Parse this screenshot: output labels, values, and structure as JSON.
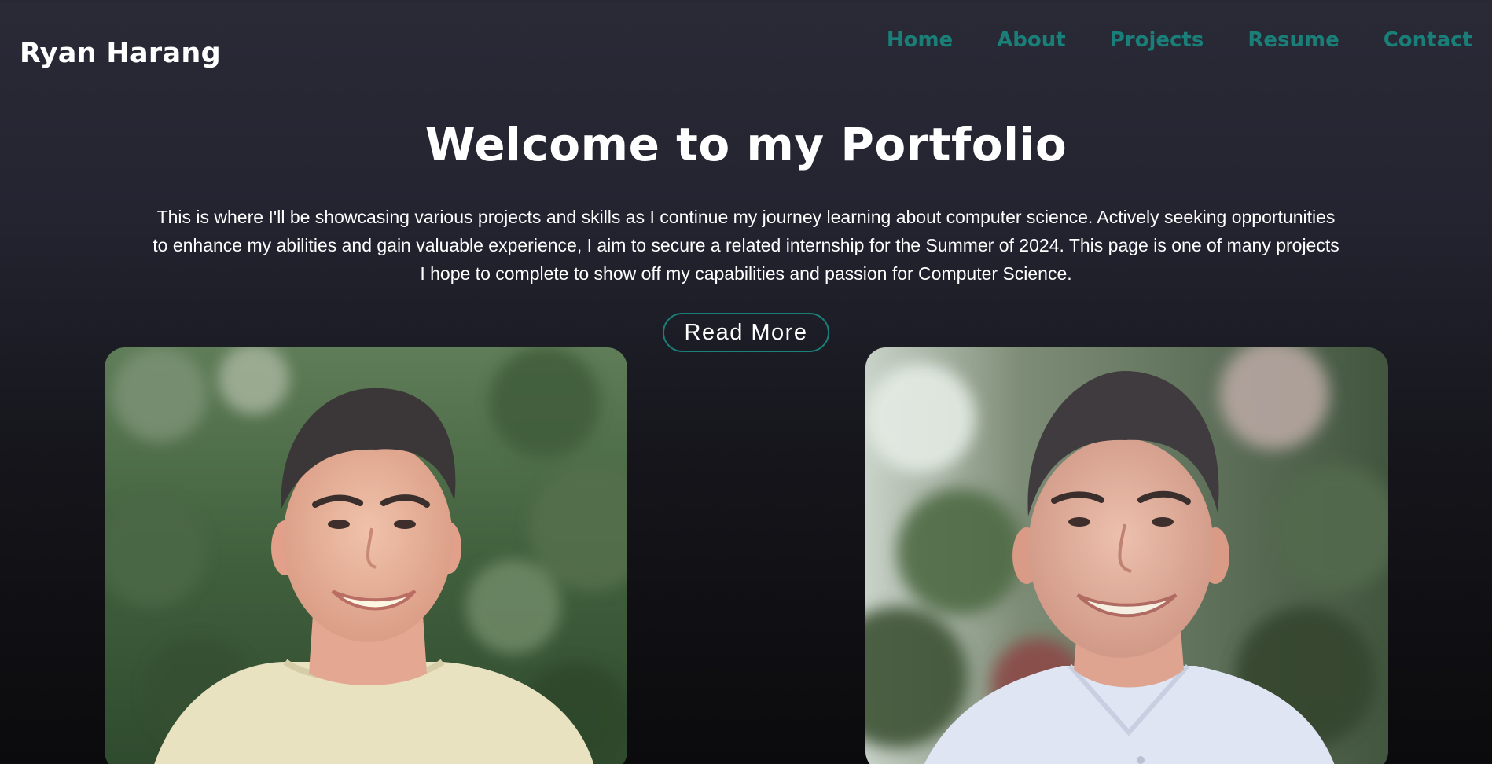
{
  "brand": {
    "name": "Ryan Harang"
  },
  "nav": {
    "items": [
      {
        "label": "Home"
      },
      {
        "label": "About"
      },
      {
        "label": "Projects"
      },
      {
        "label": "Resume"
      },
      {
        "label": "Contact"
      }
    ]
  },
  "hero": {
    "title": "Welcome to my Portfolio",
    "intro": "This is where I'll be showcasing various projects and skills as I continue my journey learning about computer science. Actively seeking opportunities to enhance my abilities and gain valuable experience, I aim to secure a related internship for the Summer of 2024. This page is one of many projects I hope to complete to show off my capabilities and passion for Computer Science.",
    "read_more_label": "Read More"
  },
  "colors": {
    "accent": "#1a7f78",
    "background_top": "#2a2a37",
    "background_bottom": "#0b0b0d",
    "text": "#ffffff"
  }
}
